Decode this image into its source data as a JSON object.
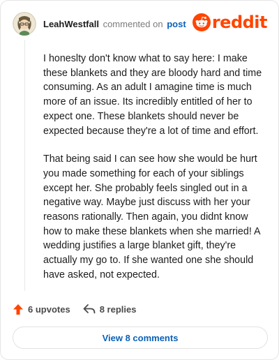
{
  "comment": {
    "username": "LeahWestfall",
    "action_text": "commented on",
    "post_link": "post",
    "paragraphs": [
      "I honeslty don't know what to say here: I make these blankets and they are bloody hard and time consuming. As an adult I amagine time is much more of an issue. Its incredibly entitled of her to expect one. These blankets should never be expected because they're a lot of time and effort.",
      "That being said I can see how she would be hurt you made something for each of your siblings except her. She probably feels singled out in a negative way. Maybe just discuss with her your reasons rationally. Then again, you didnt know how to make these blankets when she married! A wedding justifies a large blanket gift, they're actually my go to. If she wanted one she should have asked, not expected."
    ],
    "upvotes_label": "6 upvotes",
    "replies_label": "8 replies",
    "view_button_label": "View 8 comments"
  },
  "brand": {
    "wordmark": "reddit",
    "accent": "#ff4500",
    "link_color": "#0a61b8"
  },
  "icons": {
    "avatar": "user-avatar",
    "logo": "reddit-alien-icon",
    "upvote": "upvote-arrow-icon",
    "reply": "reply-arrow-icon"
  }
}
